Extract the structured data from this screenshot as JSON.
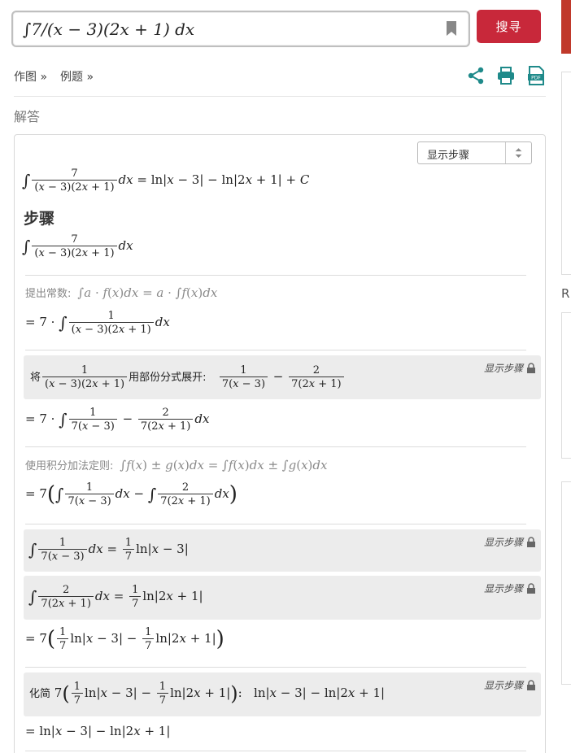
{
  "search": {
    "query": "∫7/(x − 3)(2x + 1) dx",
    "button_label": "搜寻"
  },
  "toolbar": {
    "plot_label": "作图 »",
    "examples_label": "例题 »"
  },
  "solution": {
    "section_title": "解答",
    "steps_select_value": "显示步骤",
    "steps_heading": "步骤",
    "show_steps_label": "显示步骤",
    "rule_constant": "提出常数:",
    "rule_partial_fraction": "用部份分式展开:",
    "rule_partial_fraction_prefix": "将",
    "rule_sum": "使用积分加法定则:",
    "simplify_prefix": "化简"
  },
  "colors": {
    "brand_red": "#c8283a",
    "accent_teal": "#1f8a8a",
    "box_gray": "#ececec"
  },
  "icons": [
    "bookmark-icon",
    "share-icon",
    "print-icon",
    "pdf-icon",
    "lock-icon",
    "select-arrows-icon"
  ]
}
